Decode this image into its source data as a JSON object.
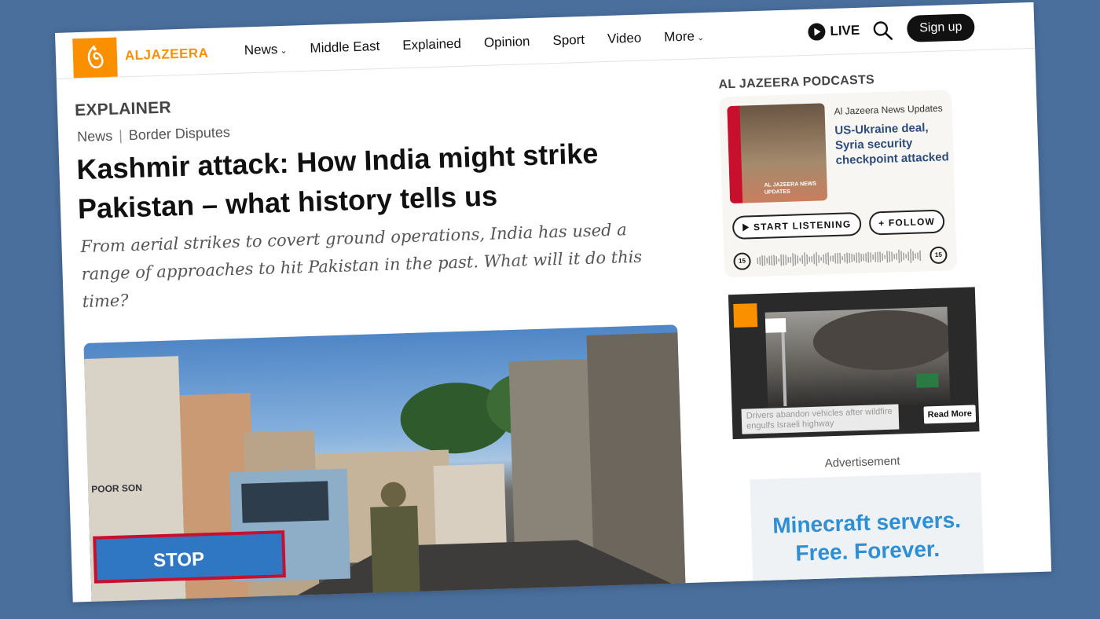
{
  "site": {
    "logo_text": "ALJAZEERA"
  },
  "nav": {
    "items": [
      {
        "label": "News",
        "dropdown": true
      },
      {
        "label": "Middle East",
        "dropdown": false
      },
      {
        "label": "Explained",
        "dropdown": false
      },
      {
        "label": "Opinion",
        "dropdown": false
      },
      {
        "label": "Sport",
        "dropdown": false
      },
      {
        "label": "Video",
        "dropdown": false
      },
      {
        "label": "More",
        "dropdown": true
      }
    ],
    "live_label": "LIVE",
    "signup_label": "Sign up"
  },
  "article": {
    "kicker": "EXPLAINER",
    "breadcrumb": [
      "News",
      "Border Disputes"
    ],
    "headline": "Kashmir attack: How India might strike Pakistan – what history tells us",
    "standfirst": "From aerial strikes to covert ground operations, India has used a range of approaches to hit Pakistan in the past. What will it do this time?",
    "hero_sign_text": "STOP",
    "hero_shop_text": "POOR SON"
  },
  "podcast": {
    "heading": "AL JAZEERA PODCASTS",
    "source": "Al Jazeera News Updates",
    "title": "US-Ukraine deal, Syria security checkpoint attacked",
    "thumb_caption": "AL JAZEERA NEWS UPDATES",
    "listen_label": "START LISTENING",
    "follow_label": "+ FOLLOW",
    "skip_back": "15",
    "skip_forward": "15"
  },
  "video": {
    "caption": "Drivers abandon vehicles after wildfire engulfs Israeli highway",
    "read_more": "Read More"
  },
  "ad": {
    "label": "Advertisement",
    "line1": "Minecraft servers.",
    "line2": "Free. Forever."
  },
  "colors": {
    "brand_orange": "#fa9000",
    "background": "#4a6f9c",
    "podcast_title": "#2d4c7a",
    "ad_text": "#2f8fd5"
  }
}
